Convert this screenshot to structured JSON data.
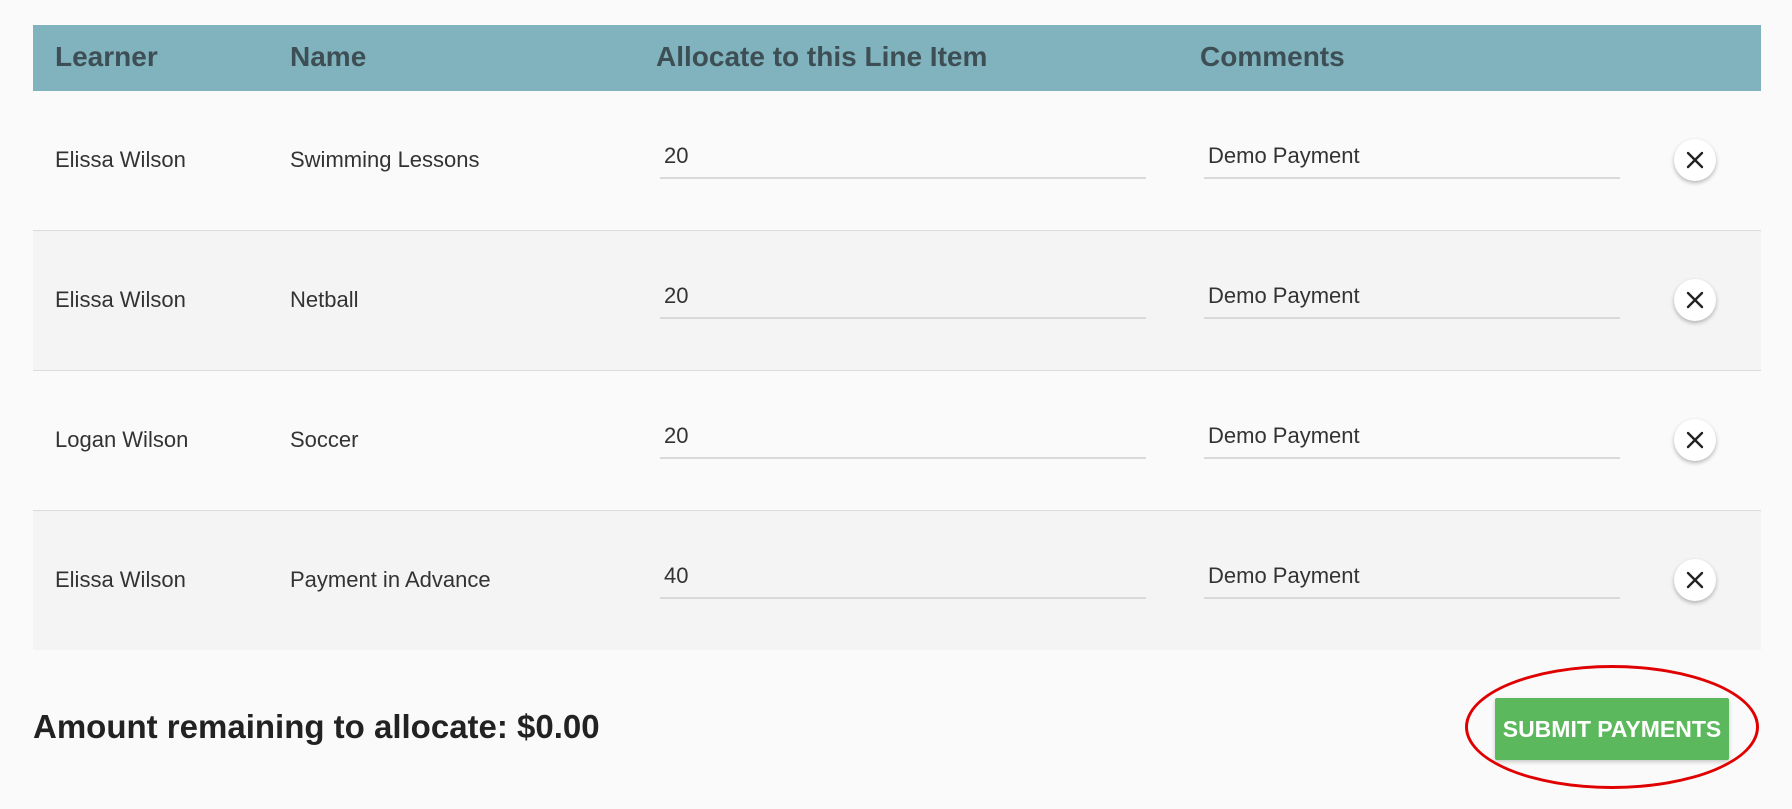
{
  "table": {
    "headers": {
      "learner": "Learner",
      "name": "Name",
      "allocate": "Allocate to this Line Item",
      "comments": "Comments"
    },
    "rows": [
      {
        "learner": "Elissa Wilson",
        "name": "Swimming Lessons",
        "amount": "20",
        "comment": "Demo Payment"
      },
      {
        "learner": "Elissa Wilson",
        "name": "Netball",
        "amount": "20",
        "comment": "Demo Payment"
      },
      {
        "learner": "Logan Wilson",
        "name": "Soccer",
        "amount": "20",
        "comment": "Demo Payment"
      },
      {
        "learner": "Elissa Wilson",
        "name": "Payment in Advance",
        "amount": "40",
        "comment": "Demo Payment"
      }
    ]
  },
  "footer": {
    "remaining_label": "Amount remaining to allocate: $0.00",
    "submit_label": "SUBMIT PAYMENTS"
  },
  "colors": {
    "header_bg": "#80b3be",
    "submit_bg": "#5cb85c",
    "highlight": "#e00000"
  },
  "icons": {
    "remove": "close-icon"
  }
}
